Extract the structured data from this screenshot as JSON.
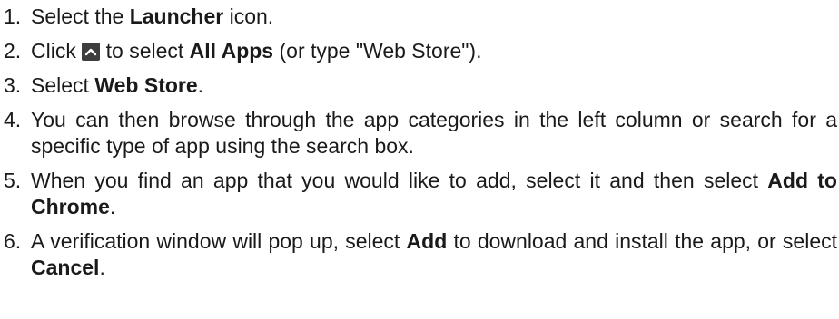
{
  "steps": [
    {
      "num": "1.",
      "t1": "Select the ",
      "b1": "Launcher",
      "t2": " icon."
    },
    {
      "num": "2.",
      "t1": "Click ",
      "icon": "chevron-up-icon",
      "t2": " to select ",
      "b1": "All Apps",
      "t3": " (or type \"Web Store\")."
    },
    {
      "num": "3.",
      "t1": "Select ",
      "b1": "Web Store",
      "t2": "."
    },
    {
      "num": "4.",
      "text": "You can then browse through the app categories in the left column or search for a specific type of app using the search box."
    },
    {
      "num": "5.",
      "t1": "When you find an app that you would like to add, select it and then select ",
      "b1": "Add to Chrome",
      "t2": "."
    },
    {
      "num": "6.",
      "t1": "A verification window will pop up, select ",
      "b1": "Add",
      "t2": " to download and install the app, or select ",
      "b2": "Cancel",
      "t3": "."
    }
  ],
  "colors": {
    "text": "#1a1a1a",
    "icon_background": "#3d3d3d",
    "icon_glyph": "#ffffff"
  }
}
